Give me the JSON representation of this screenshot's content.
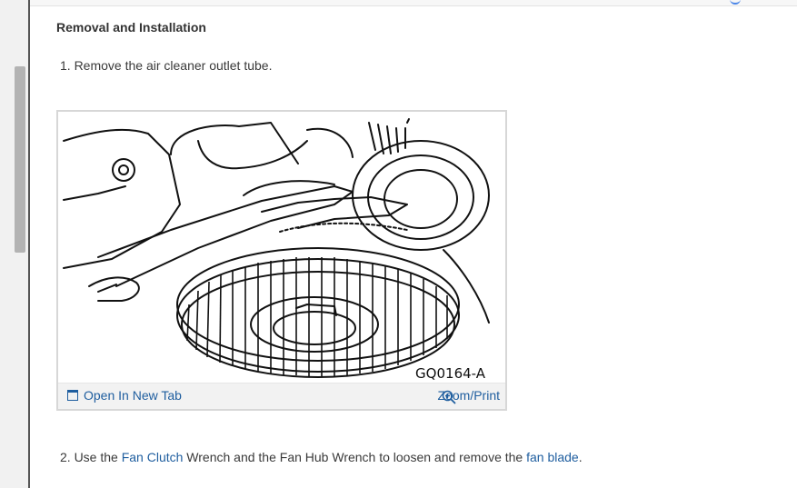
{
  "section": {
    "title": "Removal and Installation"
  },
  "steps": {
    "step1": "1. Remove the air cleaner outlet tube.",
    "step2_prefix": "2. Use the ",
    "step2_link1": "Fan Clutch",
    "step2_mid": " Wrench and the Fan Hub Wrench to loosen and remove the ",
    "step2_link2": "fan blade",
    "step2_suffix": "."
  },
  "figure": {
    "code": "GQ0164-A",
    "open_label": "Open In New Tab",
    "zoom_label": "Zoom/Print",
    "icons": {
      "open": "open-in-new-tab-icon",
      "zoom": "zoom-in-icon"
    }
  },
  "colors": {
    "link": "#1f5e9f",
    "text": "#333333"
  }
}
